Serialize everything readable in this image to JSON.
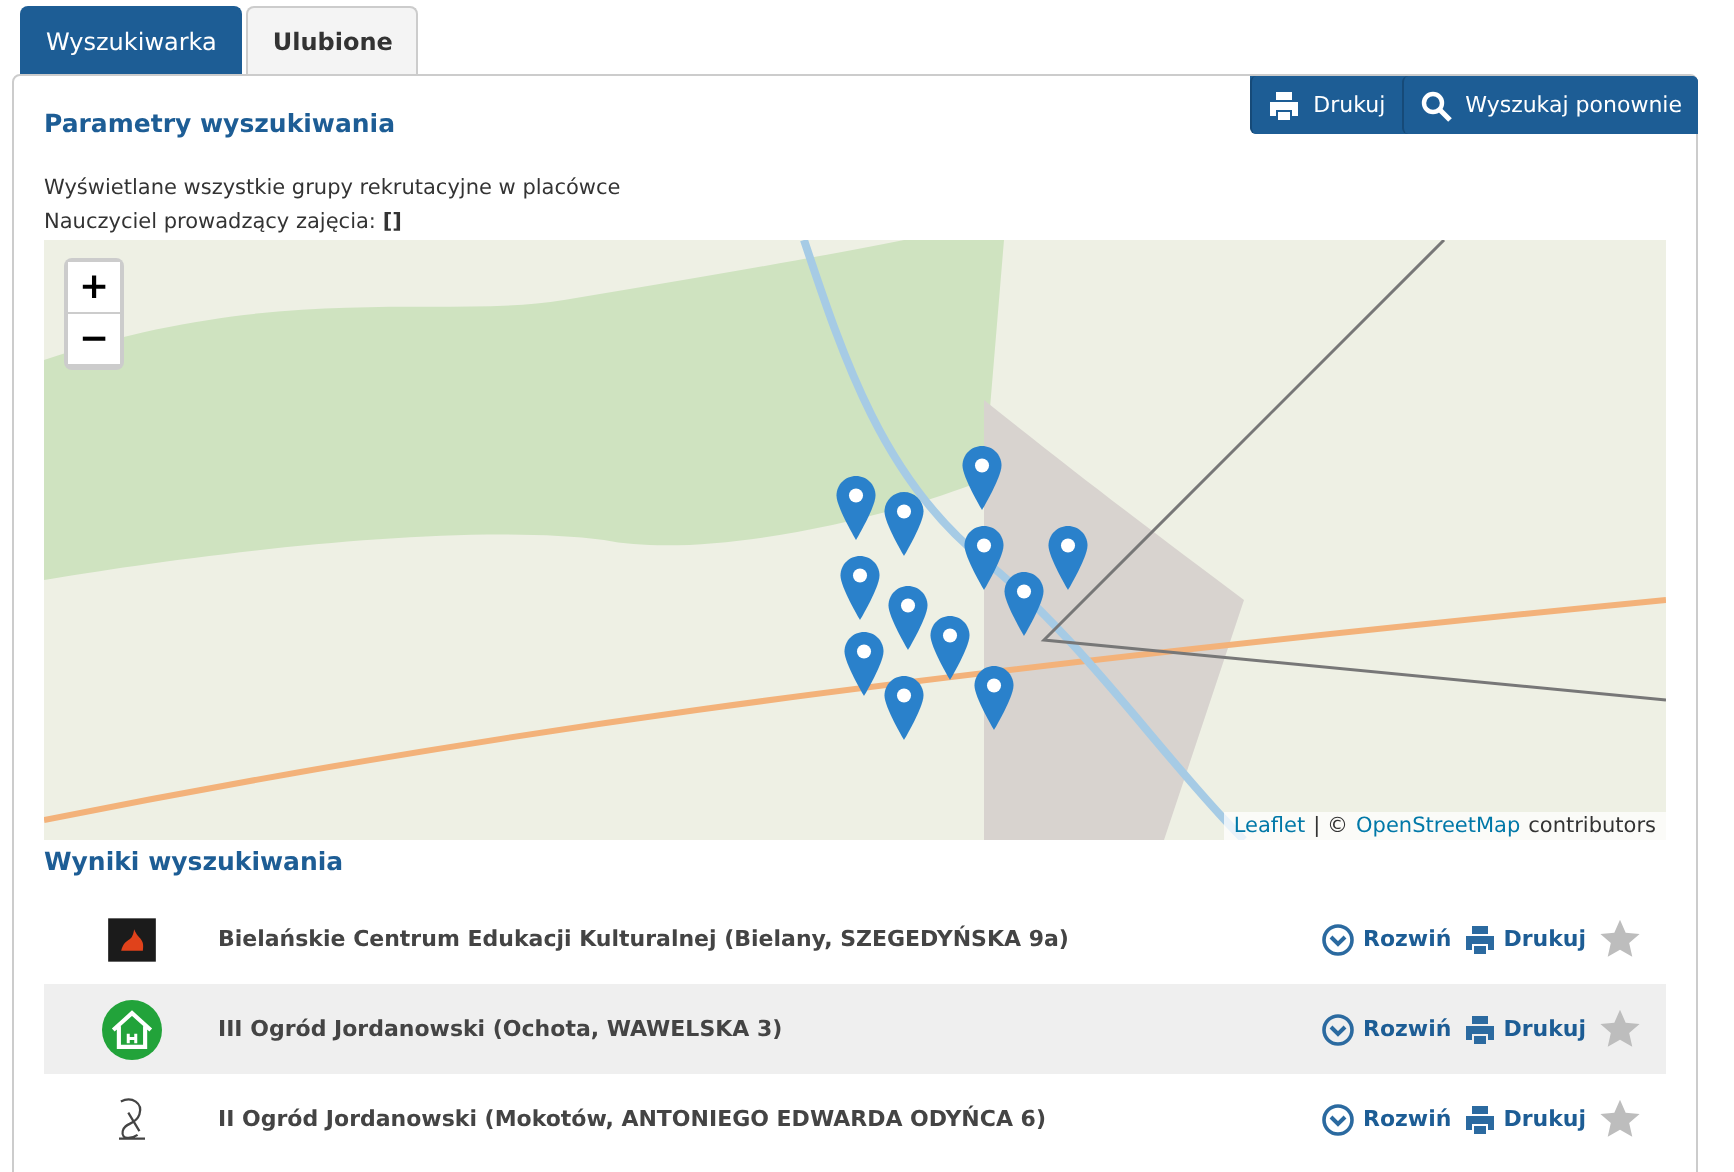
{
  "tabs": [
    {
      "label": "Wyszukiwarka",
      "selected": true
    },
    {
      "label": "Ulubione",
      "selected": false
    }
  ],
  "panel": {
    "title": "Parametry wyszukiwania",
    "buttons": [
      {
        "kind": "print",
        "label": "Drukuj"
      },
      {
        "kind": "search",
        "label": "Wyszukaj ponownie"
      }
    ],
    "info": [
      "Wyświetlane wszystkie grupy rekrutacyjne w placówce",
      "Nauczyciel prowadzący zajęcia: **[]**"
    ]
  },
  "map": {
    "zoom_in": "+",
    "zoom_out": "−",
    "attribution": {
      "leaflet": "Leaflet",
      "separator": "| ©",
      "osm": "OpenStreetMap",
      "suffix": "contributors"
    }
  },
  "results": {
    "title": "Wyniki wyszukiwania",
    "rows": [
      {
        "kind": "emblem",
        "name": "Bielańskie Centrum Edukacji Kulturalnej (Bielany, SZEGEDYŃSKA 9a)",
        "expand": "Rozwiń",
        "print": "Drukuj",
        "favorite": false
      },
      {
        "kind": "house",
        "name": "III Ogród Jordanowski (Ochota, WAWELSKA 3)",
        "expand": "Rozwiń",
        "print": "Drukuj",
        "favorite": false
      },
      {
        "kind": "sketch",
        "name": "II Ogród Jordanowski (Mokotów, ANTONIEGO EDWARDA ODYŃCA 6)",
        "expand": "Rozwiń",
        "print": "Drukuj",
        "favorite": false
      }
    ]
  }
}
